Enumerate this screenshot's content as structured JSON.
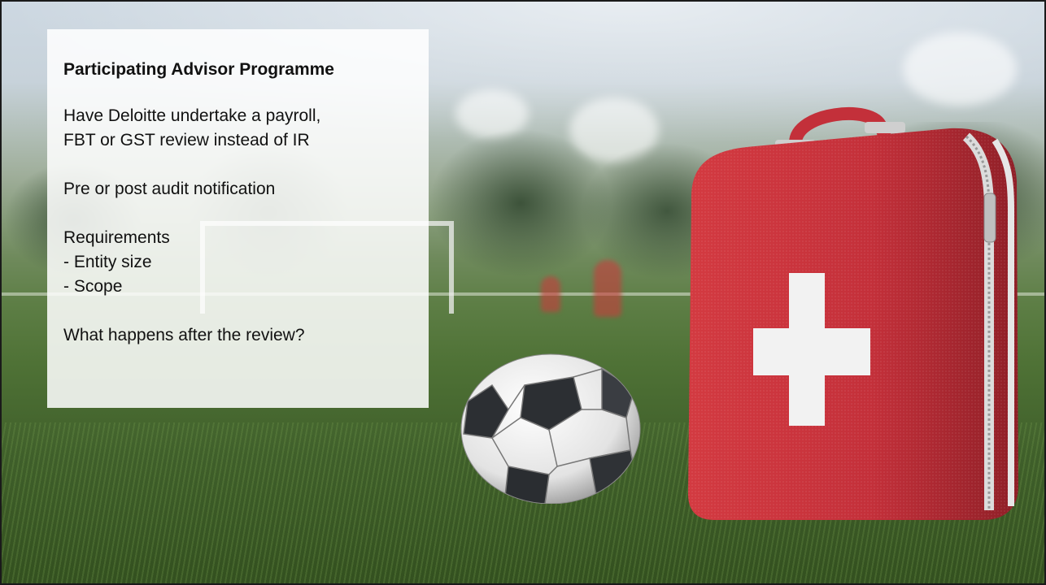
{
  "slide": {
    "title": "Participating Advisor Programme",
    "paragraph1": {
      "line1": "Have Deloitte undertake a payroll,",
      "line2": "FBT or GST review instead of IR"
    },
    "paragraph2": "Pre or post audit notification",
    "paragraph3": {
      "heading": "Requirements",
      "item1": "- Entity size",
      "item2": "- Scope"
    },
    "paragraph4": "What happens after the review?"
  },
  "colors": {
    "bag_red": "#c8323a",
    "cross_white": "#f2f2f2",
    "panel_bg": "#ffffff"
  },
  "icons": [
    "soccer-ball-image",
    "first-aid-kit-image"
  ]
}
